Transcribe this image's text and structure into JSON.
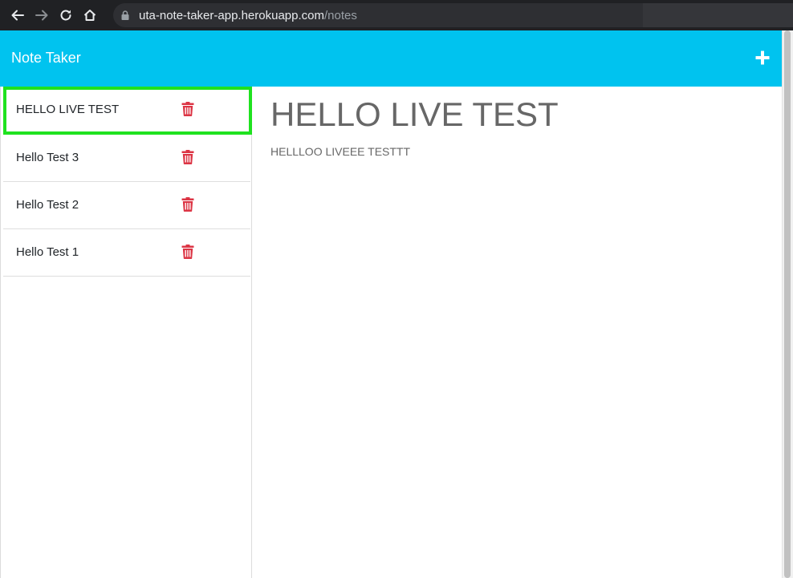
{
  "browser": {
    "url_host": "uta-note-taker-app.herokuapp.com",
    "url_path": "/notes"
  },
  "app": {
    "title": "Note Taker"
  },
  "notes": [
    {
      "title": "HELLO LIVE TEST",
      "active": true
    },
    {
      "title": "Hello Test 3",
      "active": false
    },
    {
      "title": "Hello Test 2",
      "active": false
    },
    {
      "title": "Hello Test 1",
      "active": false
    }
  ],
  "active_note": {
    "title": "HELLO LIVE TEST",
    "text": "HELLLOO LIVEEE TESTTT"
  },
  "colors": {
    "header": "#00c3ef",
    "active_outline": "#1fe21f",
    "trash_icon": "#dc3545",
    "text_muted": "#676767"
  },
  "icons": {
    "back": "arrow-left-icon",
    "forward": "arrow-right-icon",
    "reload": "reload-icon",
    "home": "home-icon",
    "lock": "lock-icon",
    "new_note": "plus-icon",
    "delete": "trash-icon"
  }
}
